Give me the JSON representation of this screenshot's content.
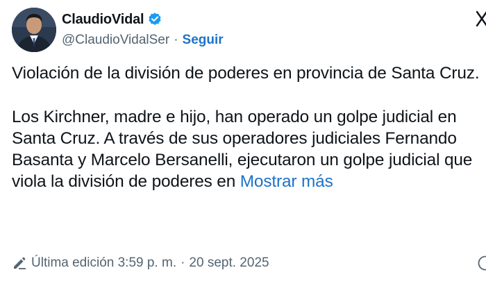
{
  "author": {
    "display_name": "ClaudioVidal",
    "handle": "@ClaudioVidalSer",
    "separator": "·",
    "follow_label": "Seguir",
    "verified": true,
    "accent_color": "#1d9bf0"
  },
  "tweet": {
    "text": "Violación de la división de poderes en provincia de Santa Cruz.\n\nLos Kirchner, madre e hijo, han operado un golpe judicial en Santa Cruz. A través de sus operadores judiciales Fernando Basanta y Marcelo Bersanelli, ejecutaron un golpe judicial que viola la división de poderes en ",
    "show_more_label": "Mostrar más"
  },
  "meta": {
    "edited_label": "Última edición 3:59 p. m.",
    "separator": "·",
    "date": "20 sept. 2025"
  },
  "icons": {
    "avatar": "avatar",
    "verified": "verified-badge-icon",
    "close": "close-icon",
    "edit": "pencil-icon",
    "info": "info-icon"
  },
  "colors": {
    "link": "#1d73c9",
    "secondary_text": "#536471",
    "primary_text": "#0f1419"
  }
}
